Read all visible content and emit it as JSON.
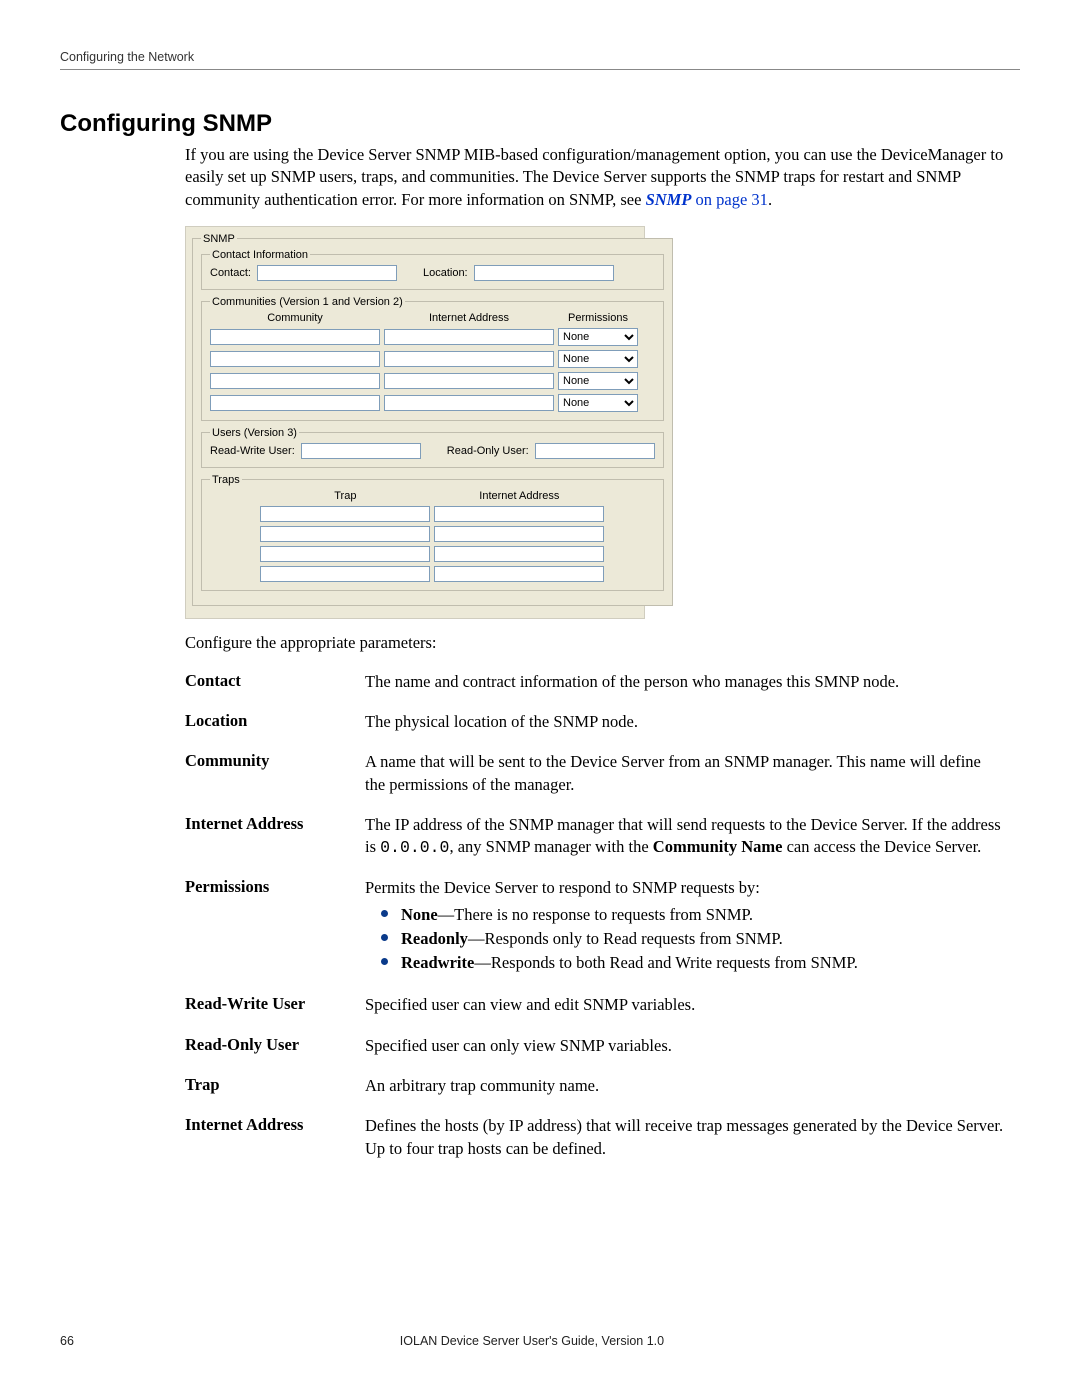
{
  "header": "Configuring the Network",
  "title": "Configuring SNMP",
  "intro": {
    "part1": "If you are using the Device Server SNMP MIB-based configuration/management option, you can use the DeviceManager to easily set up SNMP users, traps, and communities. The Device Server supports the SNMP traps for restart and SNMP community authentication error. For more information on SNMP, see ",
    "link": "SNMP",
    "linkpg": " on page 31",
    "end": "."
  },
  "dialog": {
    "root": "SNMP",
    "contact_group": "Contact Information",
    "contact_label": "Contact:",
    "location_label": "Location:",
    "comm_group": "Communities (Version 1 and Version 2)",
    "comm_col1": "Community",
    "comm_col2": "Internet Address",
    "comm_col3": "Permissions",
    "perm_option": "None",
    "users_group": "Users (Version 3)",
    "rw_label": "Read-Write User:",
    "ro_label": "Read-Only User:",
    "traps_group": "Traps",
    "trap_col1": "Trap",
    "trap_col2": "Internet Address"
  },
  "param_intro": "Configure the appropriate parameters:",
  "params": {
    "contact": {
      "name": "Contact",
      "desc": "The name and contract information of the person who manages this SMNP node."
    },
    "location": {
      "name": "Location",
      "desc": "The physical location of the SNMP node."
    },
    "community": {
      "name": "Community",
      "desc": "A name that will be sent to the Device Server from an SNMP manager. This name will define the permissions of the manager."
    },
    "inetaddr": {
      "name": "Internet Address",
      "pre": "The IP address of the SNMP manager that will send requests to the Device Server. If the address is ",
      "mono": "0.0.0.0",
      "mid": ", any SNMP manager with the ",
      "bold": "Community Name",
      "post": " can access the Device Server."
    },
    "permissions": {
      "name": "Permissions",
      "lead": "Permits the Device Server to respond to SNMP requests by:",
      "none_b": "None",
      "none_t": "—There is no response to requests from SNMP.",
      "ro_b": "Readonly",
      "ro_t": "—Responds only to Read requests from SNMP.",
      "rw_b": "Readwrite",
      "rw_t": "—Responds to both Read and Write requests from SNMP."
    },
    "rwuser": {
      "name": "Read-Write User",
      "desc": "Specified user can view and edit SNMP variables."
    },
    "rouser": {
      "name": "Read-Only User",
      "desc": "Specified user can only view SNMP variables."
    },
    "trap": {
      "name": "Trap",
      "desc": "An arbitrary trap community name."
    },
    "trapaddr": {
      "name": "Internet Address",
      "desc": "Defines the hosts (by IP address) that will receive trap messages generated by the Device Server. Up to four trap hosts can be defined."
    }
  },
  "footer": {
    "page": "66",
    "text": "IOLAN Device Server User's Guide, Version 1.0"
  }
}
